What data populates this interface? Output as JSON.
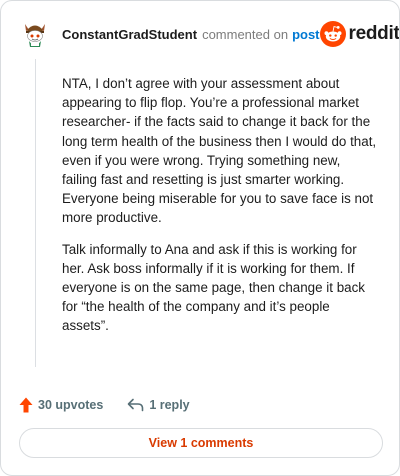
{
  "comment": {
    "username": "ConstantGradStudent",
    "action_text": "commented on",
    "post_link": "post",
    "brand": "reddit",
    "avatar_icon": "snoo-avatar-icon",
    "brand_icon": "reddit-logo-icon",
    "paragraphs": [
      "NTA, I don’t agree with your assessment about appearing to flip flop. You’re a professional market researcher- if the facts said to change it back for the long term health of the business then I would do that, even if you were wrong. Trying something new, failing fast and resetting is just smarter working. Everyone being miserable for you to save face is not more productive.",
      "Talk informally to Ana and ask if this is working for her. Ask boss informally if it is working for them. If everyone is on the same page, then change it back for “the health of the company and it’s people assets”."
    ]
  },
  "actions": {
    "upvotes": "30 upvotes",
    "replies": "1 reply",
    "upvote_icon": "upvote-arrow-icon",
    "reply_icon": "reply-arrow-icon"
  },
  "view_button": {
    "label": "View 1 comments"
  },
  "colors": {
    "accent": "#d93a00",
    "reddit_orange": "#ff4500",
    "link_blue": "#0079d3",
    "muted": "#576f76"
  }
}
